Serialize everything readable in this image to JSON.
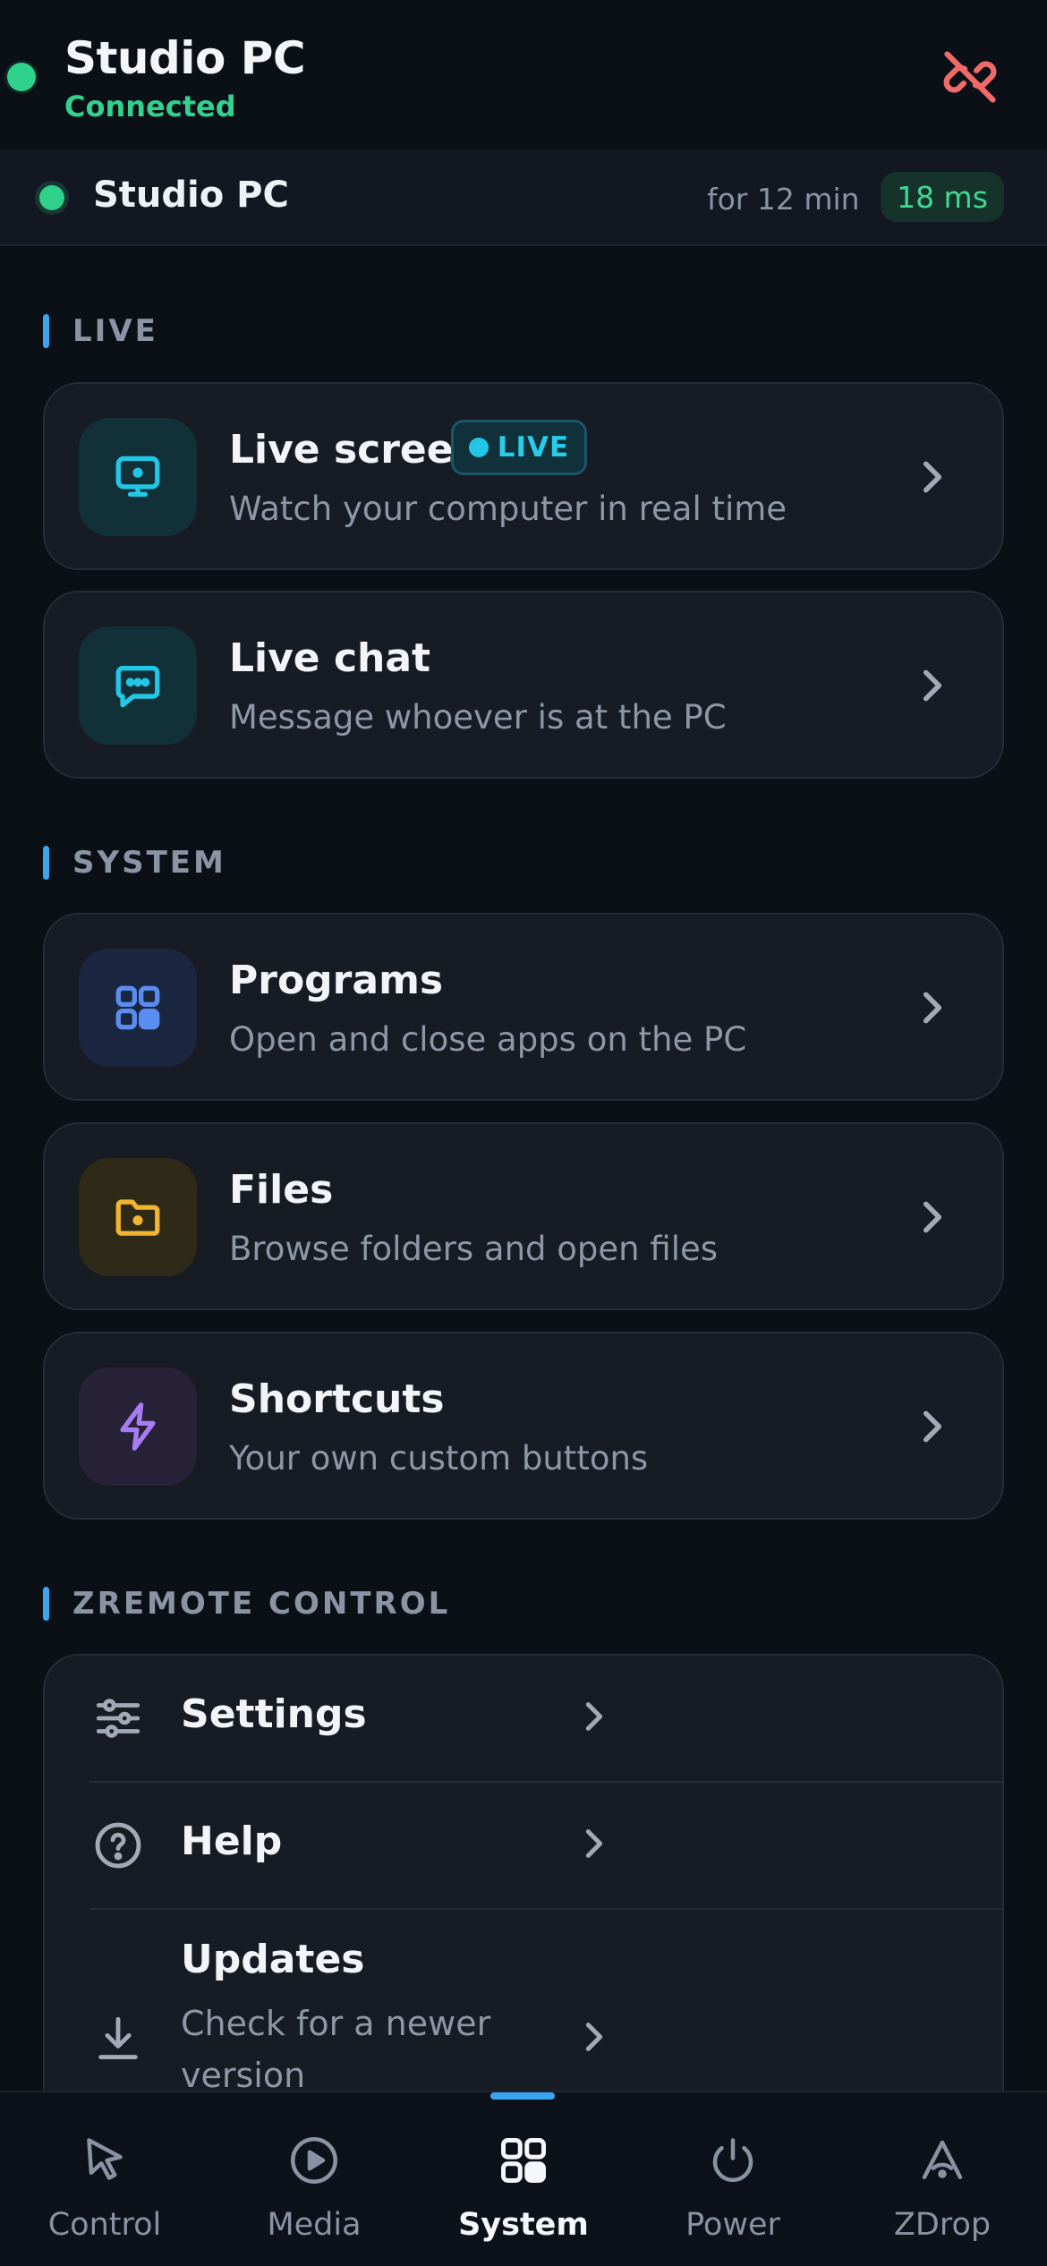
{
  "header": {
    "title": "Studio PC",
    "status": "Connected",
    "disconnect_icon": "link-off-icon",
    "status_color": "#2fd08a",
    "disconnect_color": "#f06a6a"
  },
  "session": {
    "name": "Studio PC",
    "duration": "for 12 min",
    "ping": "18 ms"
  },
  "sections": {
    "live": "LIVE",
    "system": "SYSTEM",
    "zremote": "ZREMOTE CONTROL"
  },
  "cards": {
    "live_screen": {
      "title": "Live screen",
      "subtitle": "Watch your computer in real time",
      "badge": "LIVE",
      "icon": "monitor-icon",
      "accent": "#22c7e6"
    },
    "live_chat": {
      "title": "Live chat",
      "subtitle": "Message whoever is at the PC",
      "icon": "chat-bubble-icon",
      "accent": "#22c7e6"
    },
    "programs": {
      "title": "Programs",
      "subtitle": "Open and close apps on the PC",
      "icon": "apps-grid-icon",
      "accent": "#5b8cf0"
    },
    "files": {
      "title": "Files",
      "subtitle": "Browse folders and open files",
      "icon": "folder-icon",
      "accent": "#f2b531"
    },
    "shortcuts": {
      "title": "Shortcuts",
      "subtitle": "Your own custom buttons",
      "icon": "lightning-icon",
      "accent": "#a77cf5"
    }
  },
  "settings_list": {
    "settings": {
      "title": "Settings",
      "icon": "sliders-icon"
    },
    "help": {
      "title": "Help",
      "icon": "help-circle-icon"
    },
    "updates": {
      "title": "Updates",
      "subtitle": "Check for a newer version",
      "icon": "download-icon"
    }
  },
  "bottom_nav": {
    "active": "System",
    "items": [
      {
        "label": "Control",
        "icon": "cursor-pointer-icon"
      },
      {
        "label": "Media",
        "icon": "play-circle-icon"
      },
      {
        "label": "System",
        "icon": "apps-grid-icon"
      },
      {
        "label": "Power",
        "icon": "power-icon"
      },
      {
        "label": "ZDrop",
        "icon": "zdrop-icon"
      }
    ]
  }
}
